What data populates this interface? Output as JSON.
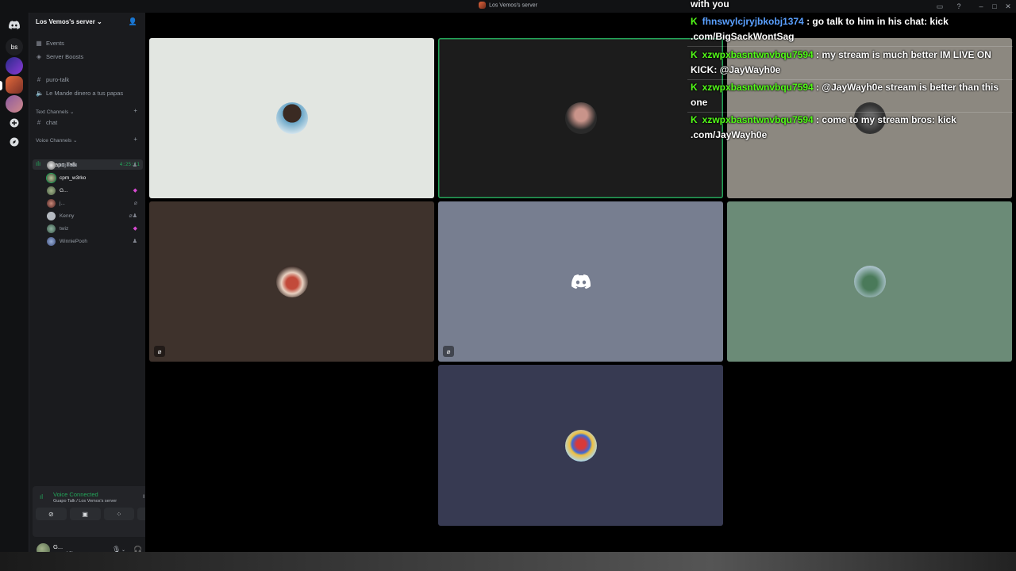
{
  "window": {
    "title": "Los Vemos's server"
  },
  "rail": {
    "bs_label": "bs"
  },
  "server": {
    "name": "Los Vemos's server ⌄"
  },
  "sidebar": {
    "events": "Events",
    "boosts": "Server Boosts",
    "channels_top": [
      "puro-talk",
      "Le Mande dinero a tus papas"
    ],
    "text_category": "Text Channels ⌄",
    "text_channels": [
      "chat"
    ],
    "voice_category": "Voice Channels ⌄",
    "voice_channel": {
      "name": "Guapo Talk",
      "timer": "4:25:11"
    },
    "members": [
      {
        "name": "bigecko"
      },
      {
        "name": "cpm_w3rko"
      },
      {
        "name": "G..."
      },
      {
        "name": "j..."
      },
      {
        "name": "Kenny"
      },
      {
        "name": "twiz"
      },
      {
        "name": "WinniePooh"
      }
    ]
  },
  "voice_panel": {
    "status": "Voice Connected",
    "location": "Guapo Talk / Los Vemos's server"
  },
  "user_panel": {
    "name": "G...",
    "status": "chilling"
  },
  "overlay": {
    "top_fragment": "with you",
    "messages": [
      {
        "user": "fhnswylcjryjbkobj1374",
        "text": ": go talk to him in his chat: kick",
        "text2": ".com/BigSackWontSag"
      },
      {
        "user": "xzwpxbasntwnvbqu7594",
        "text": ": my stream is much better IM LIVE ON",
        "text2": "KICK: @JayWayh0e"
      },
      {
        "user": "xzwpxbasntwnvbqu7594",
        "text": ": @JayWayh0e stream is better than this",
        "text2": "one"
      },
      {
        "user": "xzwpxbasntwnvbqu7594",
        "text": ": come to my stream bros: kick",
        "text2": ".com/JayWayh0e"
      }
    ]
  },
  "colors": {
    "accent_green": "#23a559",
    "kick_green": "#53fc18",
    "blurple": "#5865f2"
  }
}
